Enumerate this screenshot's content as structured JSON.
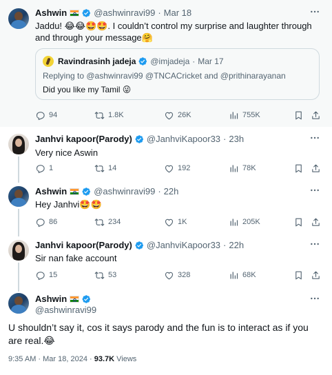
{
  "tweets": [
    {
      "name": "Ashwin",
      "handle": "@ashwinravi99",
      "time": "Mar 18",
      "text": "Jaddu! 😂😂🤩🤩. I couldn’t control my surprise and laughter through and through your message🤗",
      "quote": {
        "name": "Ravindrasinh jadeja",
        "handle": "@imjadeja",
        "time": "Mar 17",
        "replying": "Replying to @ashwinravi99 @TNCACricket and @prithinarayanan",
        "text": "Did you like my Tamil 😜"
      },
      "stats": {
        "replies": "94",
        "retweets": "1.8K",
        "likes": "26K",
        "views": "755K"
      }
    },
    {
      "name": "Janhvi kapoor(Parody)",
      "handle": "@JanhviKapoor33",
      "time": "23h",
      "text": "Very nice Aswin",
      "stats": {
        "replies": "1",
        "retweets": "14",
        "likes": "192",
        "views": "78K"
      }
    },
    {
      "name": "Ashwin",
      "handle": "@ashwinravi99",
      "time": "22h",
      "text": "Hey Janhvi🤩🤩",
      "stats": {
        "replies": "86",
        "retweets": "234",
        "likes": "1K",
        "views": "205K"
      }
    },
    {
      "name": "Janhvi kapoor(Parody)",
      "handle": "@JanhviKapoor33",
      "time": "22h",
      "text": "Sir nan fake account",
      "stats": {
        "replies": "15",
        "retweets": "53",
        "likes": "328",
        "views": "68K"
      }
    }
  ],
  "main": {
    "name": "Ashwin",
    "handle": "@ashwinravi99",
    "text": "U shouldn’t say it, cos it says parody and the fun is to interact as if you are real.😂",
    "date": "9:35 AM · Mar 18, 2024 · ",
    "views": "93.7K",
    "views_label": " Views"
  },
  "sep": "·",
  "icons": {
    "more": "more-horizontal-icon",
    "verified": "verified-badge-icon",
    "flag": "india-flag-icon",
    "reply": "reply-icon",
    "retweet": "retweet-icon",
    "like": "heart-icon",
    "views": "views-chart-icon",
    "bookmark": "bookmark-icon",
    "share": "share-icon"
  },
  "colors": {
    "verified": "#1d9bf0",
    "muted": "#536471",
    "text": "#0f1419",
    "highlight_bg": "#f7f9f9"
  }
}
